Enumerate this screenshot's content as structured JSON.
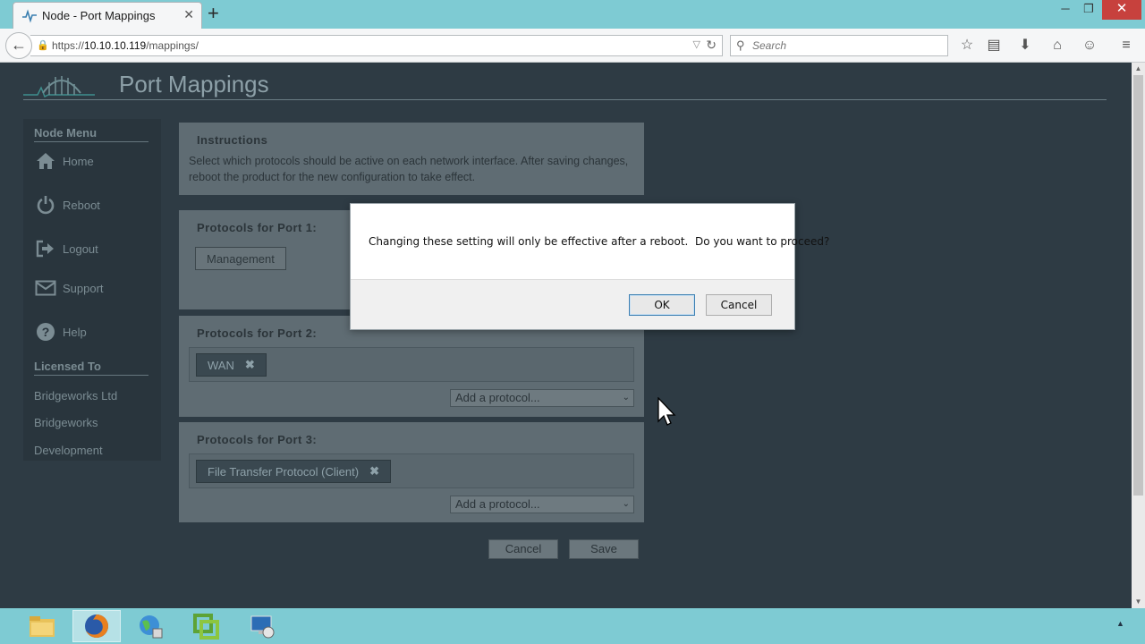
{
  "browser": {
    "tab_title": "Node - Port Mappings",
    "url_prefix": "https://",
    "url_host": "10.10.10.119",
    "url_path": "/mappings/",
    "search_placeholder": "Search"
  },
  "page": {
    "title": "Port Mappings"
  },
  "sidebar": {
    "menu_heading": "Node Menu",
    "items": [
      {
        "label": "Home",
        "icon": "home-icon"
      },
      {
        "label": "Reboot",
        "icon": "power-icon"
      },
      {
        "label": "Logout",
        "icon": "logout-icon"
      },
      {
        "label": "Support",
        "icon": "envelope-icon"
      },
      {
        "label": "Help",
        "icon": "help-icon"
      }
    ],
    "licensed_heading": "Licensed To",
    "licensed_lines": [
      "Bridgeworks Ltd",
      "Bridgeworks",
      "Development"
    ]
  },
  "instructions": {
    "heading": "Instructions",
    "text": "Select which protocols should be active on each network interface. After saving changes, reboot the product for the new configuration to take effect."
  },
  "ports": [
    {
      "heading": "Protocols for Port 1:",
      "protocols": [
        "Management"
      ],
      "removable": false
    },
    {
      "heading": "Protocols for Port 2:",
      "protocols": [
        "WAN"
      ],
      "removable": true,
      "add_placeholder": "Add a protocol..."
    },
    {
      "heading": "Protocols for Port 3:",
      "protocols": [
        "File Transfer Protocol (Client)"
      ],
      "removable": true,
      "add_placeholder": "Add a protocol..."
    }
  ],
  "actions": {
    "cancel_label": "Cancel",
    "save_label": "Save"
  },
  "dialog": {
    "message": "Changing these setting will only be effective after a reboot.  Do you want to proceed?",
    "ok_label": "OK",
    "cancel_label": "Cancel"
  },
  "colors": {
    "chrome_accent": "#7ecbd3",
    "page_background": "#2e3b44",
    "close_button": "#c7413d"
  }
}
